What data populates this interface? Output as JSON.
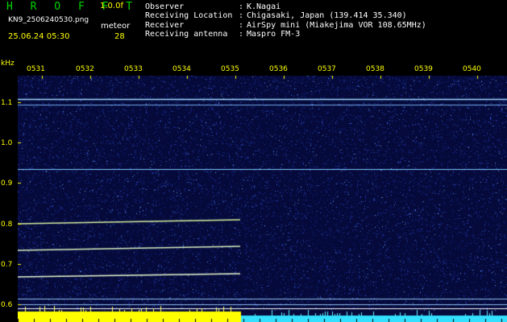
{
  "header": {
    "app_title": "H R O F F T",
    "app_version": "1.0.0f",
    "file_name": "KN9_2506240530.png",
    "timestamp": "25.06.24 05:30",
    "meteor_label": "meteor",
    "meteor_count": "28",
    "info": [
      {
        "key": "Observer",
        "value": "K.Nagai"
      },
      {
        "key": "Receiving Location",
        "value": "Chigasaki, Japan (139.414 35.340)"
      },
      {
        "key": "Receiver",
        "value": "AirSpy mini (Miakejima VOR 108.65MHz)"
      },
      {
        "key": "Receiving antenna",
        "value": "Maspro FM-3"
      }
    ],
    "separator": ":"
  },
  "axes": {
    "freq_unit": "kHz",
    "time_labels": [
      "0531",
      "0532",
      "0533",
      "0534",
      "0535",
      "0536",
      "0537",
      "0538",
      "0539",
      "0540"
    ],
    "freq_labels": [
      "1.1",
      "1.0",
      "0.9",
      "0.8",
      "0.7",
      "0.6"
    ]
  },
  "colors": {
    "background": "#000000",
    "header_green": "#00d400",
    "header_yellow": "#ffff00",
    "noise_blue": "#1a2a8c",
    "carrier": "#9fd8ff",
    "bottom_yellow": "#ffff00",
    "bottom_cyan": "#33e0ff"
  }
}
